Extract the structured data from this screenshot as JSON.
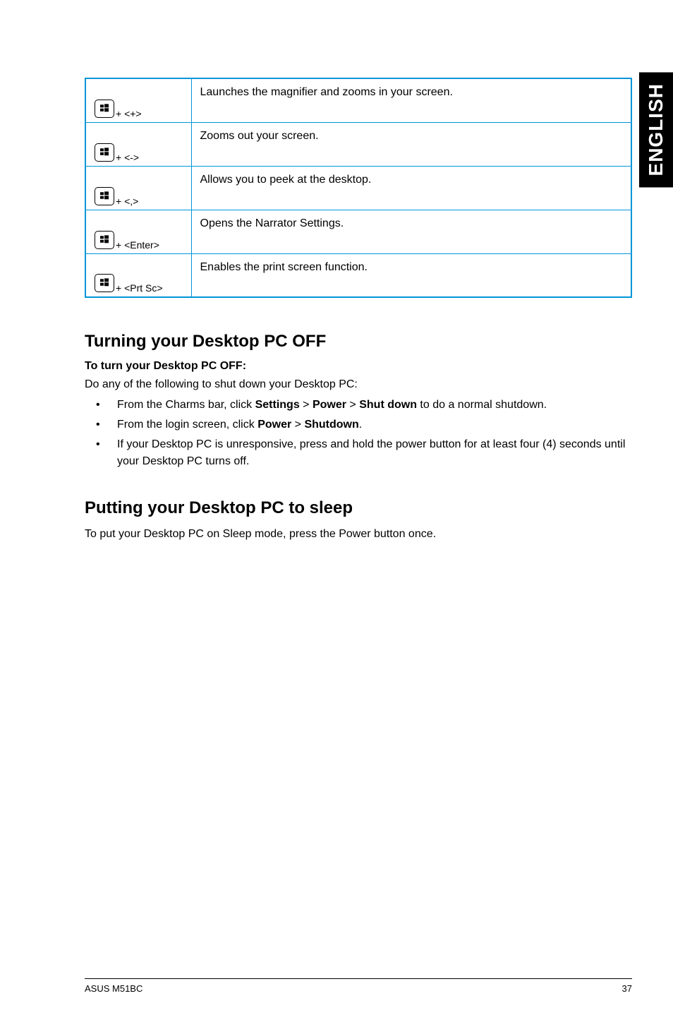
{
  "sideTab": "ENGLISH",
  "shortcuts": [
    {
      "combo": "+ <+>",
      "desc": "Launches the magnifier and zooms in your screen."
    },
    {
      "combo": "+ <->",
      "desc": "Zooms out your screen."
    },
    {
      "combo": "+ <,>",
      "desc": "Allows you to peek at the desktop."
    },
    {
      "combo": "+ <Enter>",
      "desc": "Opens the Narrator Settings."
    },
    {
      "combo": "+ <Prt Sc>",
      "desc": "Enables the print screen function."
    }
  ],
  "section1": {
    "heading": "Turning your Desktop PC OFF",
    "subhead": "To turn your Desktop PC OFF:",
    "intro": "Do any of the following to shut down your Desktop PC:",
    "bullets": {
      "b1": {
        "pre": "From the Charms bar, click ",
        "s1": "Settings",
        "gt1": " > ",
        "s2": "Power",
        "gt2": " > ",
        "s3": "Shut down",
        "post": " to do a normal shutdown."
      },
      "b2": {
        "pre": "From the login screen, click ",
        "s1": "Power",
        "gt1": " > ",
        "s2": "Shutdown",
        "post": "."
      },
      "b3": "If your Desktop PC is unresponsive, press and hold the power  button for at least four (4) seconds until your Desktop PC turns off."
    }
  },
  "section2": {
    "heading": "Putting your Desktop PC to sleep",
    "body": "To put your Desktop PC on Sleep mode, press the Power button once."
  },
  "footer": {
    "left": "ASUS M51BC",
    "right": "37"
  }
}
